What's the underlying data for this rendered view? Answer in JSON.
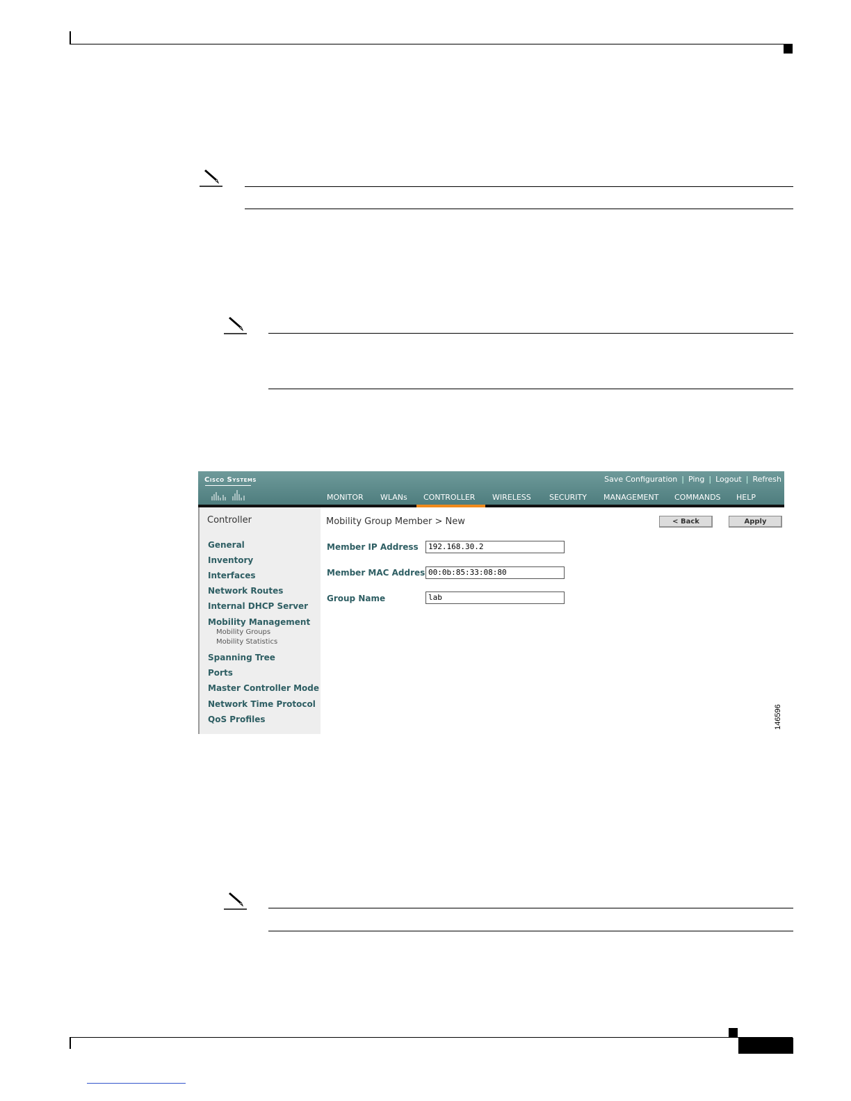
{
  "app": {
    "logo_text": "Cisco Systems",
    "header_links": [
      "Save Configuration",
      "Ping",
      "Logout",
      "Refresh"
    ],
    "nav_tabs": [
      "MONITOR",
      "WLANs",
      "CONTROLLER",
      "WIRELESS",
      "SECURITY",
      "MANAGEMENT",
      "COMMANDS",
      "HELP"
    ],
    "active_tab": "CONTROLLER",
    "colors": {
      "header": "#5a8989",
      "active_tab_underline": "#f08a1c",
      "sidebar_link": "#2e5e63",
      "sidebar_bg": "#eeeeee"
    }
  },
  "sidebar": {
    "title": "Controller",
    "items": [
      "General",
      "Inventory",
      "Interfaces",
      "Network Routes",
      "Internal DHCP Server",
      "Mobility Management"
    ],
    "sub_items": [
      "Mobility Groups",
      "Mobility Statistics"
    ],
    "items_after": [
      "Spanning Tree",
      "Ports",
      "Master Controller Mode",
      "Network Time Protocol",
      "QoS Profiles"
    ]
  },
  "main": {
    "title": "Mobility Group Member > New",
    "back_label": "< Back",
    "apply_label": "Apply",
    "fields": [
      {
        "label": "Member IP Address",
        "value": "192.168.30.2"
      },
      {
        "label": "Member MAC Address",
        "value": "00:0b:85:33:08:80"
      },
      {
        "label": "Group Name",
        "value": "lab"
      }
    ]
  },
  "figure_number": "146596"
}
